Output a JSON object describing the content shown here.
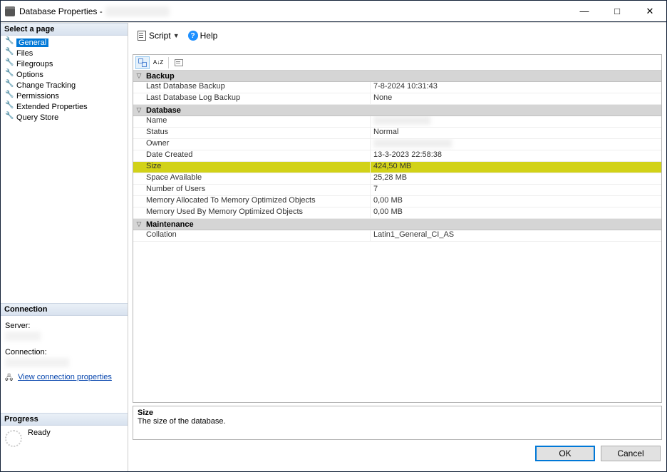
{
  "window": {
    "title_prefix": "Database Properties -"
  },
  "win_controls": {
    "min": "—",
    "max": "□",
    "close": "✕"
  },
  "left": {
    "select_page": "Select a page",
    "pages": [
      "General",
      "Files",
      "Filegroups",
      "Options",
      "Change Tracking",
      "Permissions",
      "Extended Properties",
      "Query Store"
    ],
    "connection_header": "Connection",
    "server_label": "Server:",
    "connection_label": "Connection:",
    "view_props": "View connection properties",
    "progress_header": "Progress",
    "progress_status": "Ready"
  },
  "toolbar": {
    "script": "Script",
    "help": "Help"
  },
  "grid_toolbar": {
    "az": "A↓Z"
  },
  "sections": [
    {
      "title": "Backup",
      "rows": [
        {
          "k": "Last Database Backup",
          "v": "7-8-2024 10:31:43"
        },
        {
          "k": "Last Database Log Backup",
          "v": "None"
        }
      ]
    },
    {
      "title": "Database",
      "rows": [
        {
          "k": "Name",
          "v_blur": true
        },
        {
          "k": "Status",
          "v": "Normal"
        },
        {
          "k": "Owner",
          "v_blur": true,
          "blur_lg": true
        },
        {
          "k": "Date Created",
          "v": "13-3-2023 22:58:38"
        },
        {
          "k": "Size",
          "v": "424,50 MB",
          "highlight": true
        },
        {
          "k": "Space Available",
          "v": "25,28 MB"
        },
        {
          "k": "Number of Users",
          "v": "7"
        },
        {
          "k": "Memory Allocated To Memory Optimized Objects",
          "v": "0,00 MB"
        },
        {
          "k": "Memory Used By Memory Optimized Objects",
          "v": "0,00 MB"
        }
      ]
    },
    {
      "title": "Maintenance",
      "rows": [
        {
          "k": "Collation",
          "v": "Latin1_General_CI_AS"
        }
      ]
    }
  ],
  "description": {
    "title": "Size",
    "text": "The size of the database."
  },
  "buttons": {
    "ok": "OK",
    "cancel": "Cancel"
  }
}
